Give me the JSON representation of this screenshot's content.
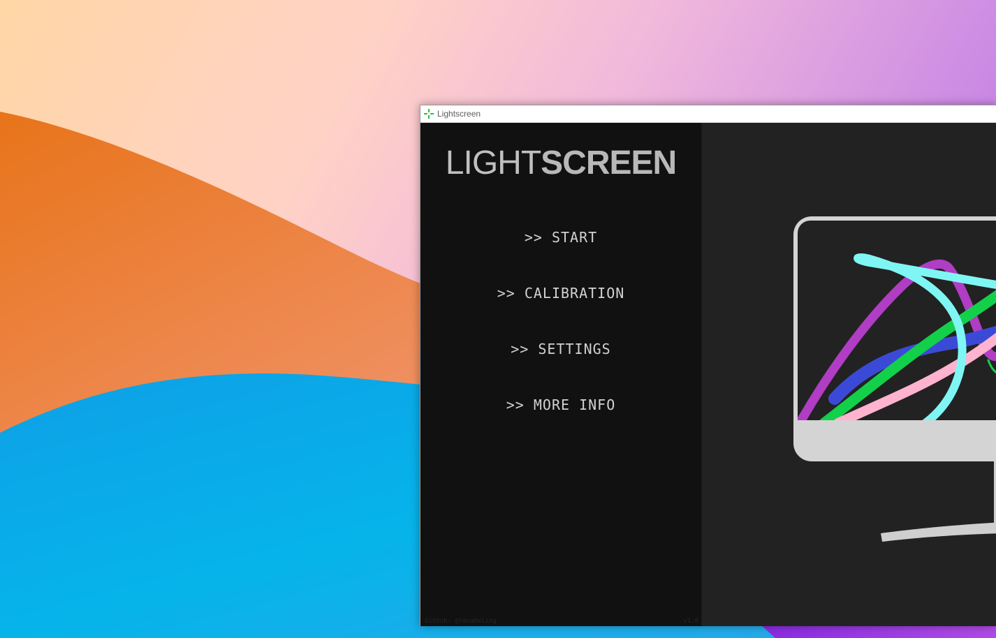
{
  "window": {
    "title": "Lightscreen",
    "icon": "green-crosshair-icon"
  },
  "sidebar": {
    "logo_light": "LIGHT",
    "logo_screen": "SCREEN",
    "menu": [
      {
        "label": ">> START"
      },
      {
        "label": ">> CALIBRATION"
      },
      {
        "label": ">> SETTINGS"
      },
      {
        "label": ">> MORE INFO"
      }
    ],
    "footer_left": "Github: @lmnaDeling",
    "footer_right": "v1.0"
  },
  "preview": {
    "illustration": "monitor-with-colored-strokes-icon",
    "stroke_colors": [
      "#b03dc4",
      "#3b4ad6",
      "#12d04a",
      "#ffb3cf",
      "#7ff6f4"
    ]
  },
  "colors": {
    "sidebar_bg": "#111111",
    "preview_bg": "#222222",
    "menu_text": "#d2d2d2"
  }
}
